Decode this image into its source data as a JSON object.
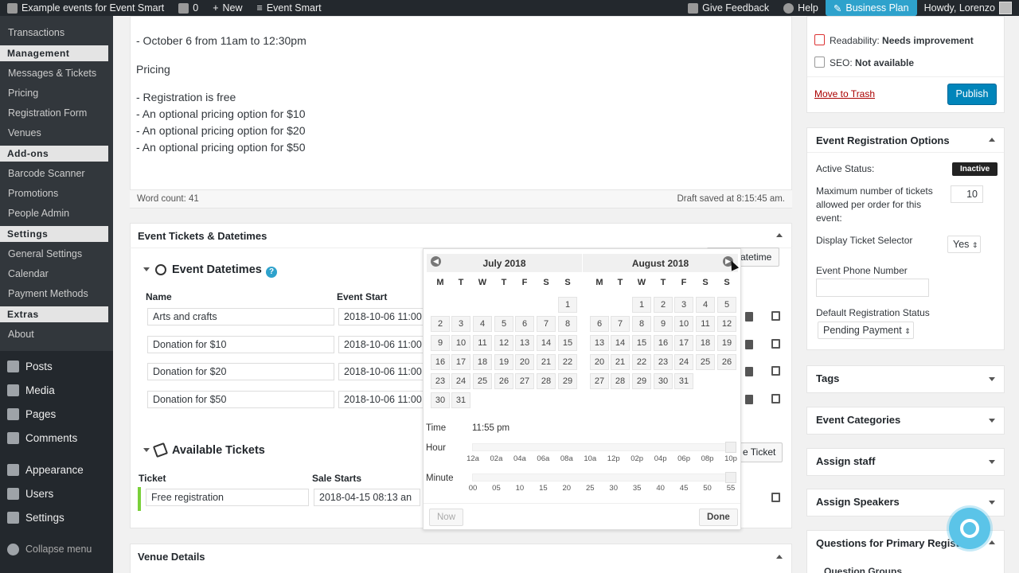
{
  "adminbar": {
    "site": "Example events for Event Smart",
    "comments": "0",
    "new": "New",
    "brand": "Event Smart",
    "feedback": "Give Feedback",
    "help": "Help",
    "plan": "Business Plan",
    "howdy": "Howdy, Lorenzo"
  },
  "sidebar": {
    "transactions": "Transactions",
    "management_head": "Management",
    "management": [
      "Messages & Tickets",
      "Pricing",
      "Registration Form",
      "Venues"
    ],
    "addons_head": "Add-ons",
    "addons": [
      "Barcode Scanner",
      "Promotions",
      "People Admin"
    ],
    "settings_head": "Settings",
    "settings": [
      "General Settings",
      "Calendar",
      "Payment Methods"
    ],
    "extras_head": "Extras",
    "extras": [
      "About"
    ],
    "top": [
      "Posts",
      "Media",
      "Pages",
      "Comments",
      "Appearance",
      "Users",
      "Settings"
    ],
    "collapse": "Collapse menu"
  },
  "editor": {
    "line1": "- October 6 from 11am to 12:30pm",
    "pricing": "Pricing",
    "items": [
      "- Registration is free",
      "- An optional pricing option for $10",
      "- An optional pricing option for $20",
      "- An optional pricing option for $50"
    ],
    "word_count": "Word count: 41",
    "draft_saved": "Draft saved at 8:15:45 am."
  },
  "tickets_box": {
    "title": "Event Tickets & Datetimes",
    "datetimes_title": "Event Datetimes",
    "col_name": "Name",
    "col_start": "Event Start",
    "rows": [
      {
        "name": "Arts and crafts",
        "start": "2018-10-06 11:00"
      },
      {
        "name": "Donation for $10",
        "start": "2018-10-06 11:00"
      },
      {
        "name": "Donation for $20",
        "start": "2018-10-06 11:00"
      },
      {
        "name": "Donation for $50",
        "start": "2018-10-06 11:00"
      }
    ],
    "add_datetime_partial": "atetime",
    "available_tickets_title": "Available Tickets",
    "col_ticket": "Ticket",
    "col_sale_starts": "Sale Starts",
    "ticket_name": "Free registration",
    "ticket_sale": "2018-04-15 08:13 an",
    "create_ticket_partial": "e Ticket"
  },
  "datepicker": {
    "month1": "July 2018",
    "month2": "August 2018",
    "dow": [
      "M",
      "T",
      "W",
      "T",
      "F",
      "S",
      "S"
    ],
    "time_label": "Time",
    "time_value": "11:55 pm",
    "hour_label": "Hour",
    "hour_ticks": [
      "12a",
      "02a",
      "04a",
      "06a",
      "08a",
      "10a",
      "12p",
      "02p",
      "04p",
      "06p",
      "08p",
      "10p"
    ],
    "minute_label": "Minute",
    "minute_ticks": [
      "00",
      "05",
      "10",
      "15",
      "20",
      "25",
      "30",
      "35",
      "40",
      "45",
      "50",
      "55"
    ],
    "now_label": "Now",
    "done_label": "Done"
  },
  "venue": {
    "title": "Venue Details"
  },
  "publish": {
    "readability_label": "Readability:",
    "readability_value": "Needs improvement",
    "seo_label": "SEO:",
    "seo_value": "Not available",
    "trash": "Move to Trash",
    "publish": "Publish"
  },
  "reg_options": {
    "title": "Event Registration Options",
    "active_status_label": "Active Status:",
    "active_status_value": "Inactive",
    "max_tickets_label": "Maximum number of tickets allowed per order for this event:",
    "max_tickets_value": "10",
    "display_selector_label": "Display Ticket Selector",
    "display_selector_value": "Yes",
    "phone_label": "Event Phone Number",
    "phone_value": "",
    "default_status_label": "Default Registration Status",
    "default_status_value": "Pending Payment"
  },
  "right_boxes": {
    "tags": "Tags",
    "categories": "Event Categories",
    "staff": "Assign staff",
    "speakers": "Assign Speakers",
    "questions": "Questions for Primary Registrant",
    "question_groups": "Question Groups"
  },
  "colors": {
    "accent": "#0085ba",
    "sidebar": "#23282d",
    "trash": "#a00",
    "bubble": "#5bc4e8"
  }
}
